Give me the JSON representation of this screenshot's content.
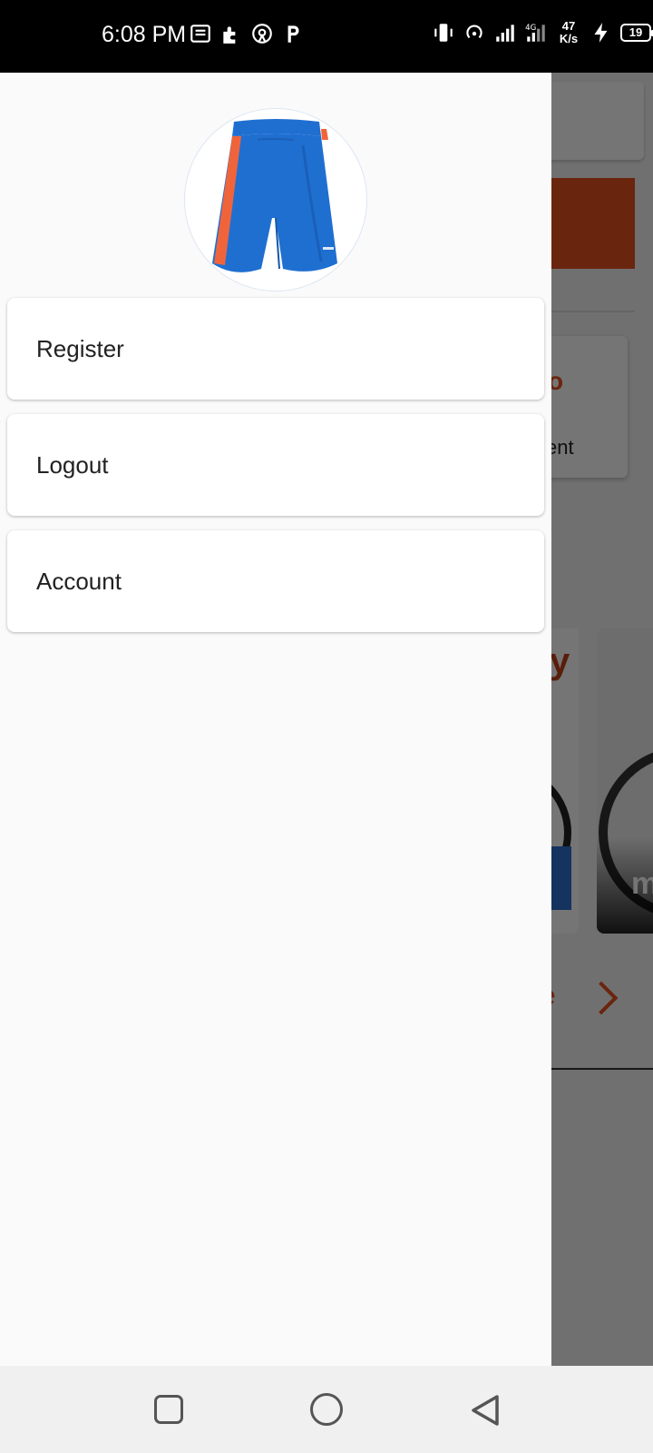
{
  "status_bar": {
    "time": "6:08 PM",
    "network_speed_value": "47",
    "network_speed_unit": "K/s",
    "network_type": "4G",
    "battery_level": "19"
  },
  "drawer": {
    "header_image": "blue-shorts-product-image",
    "menu_items": [
      {
        "label": "Register"
      },
      {
        "label": "Logout"
      },
      {
        "label": "Account"
      }
    ]
  },
  "background": {
    "fragment_letter_o": "o",
    "fragment_text_ent": "ent",
    "fragment_letter_y": "y",
    "fragment_letter_m": "m",
    "fragment_letter_e": "e"
  },
  "colors": {
    "accent": "#e8521f",
    "drawer_bg": "#fafafa",
    "shorts_blue": "#1f6fd1",
    "shorts_stripe": "#f0643c"
  },
  "nav_bar": {
    "icons": [
      "recents-icon",
      "home-icon",
      "back-icon"
    ]
  }
}
